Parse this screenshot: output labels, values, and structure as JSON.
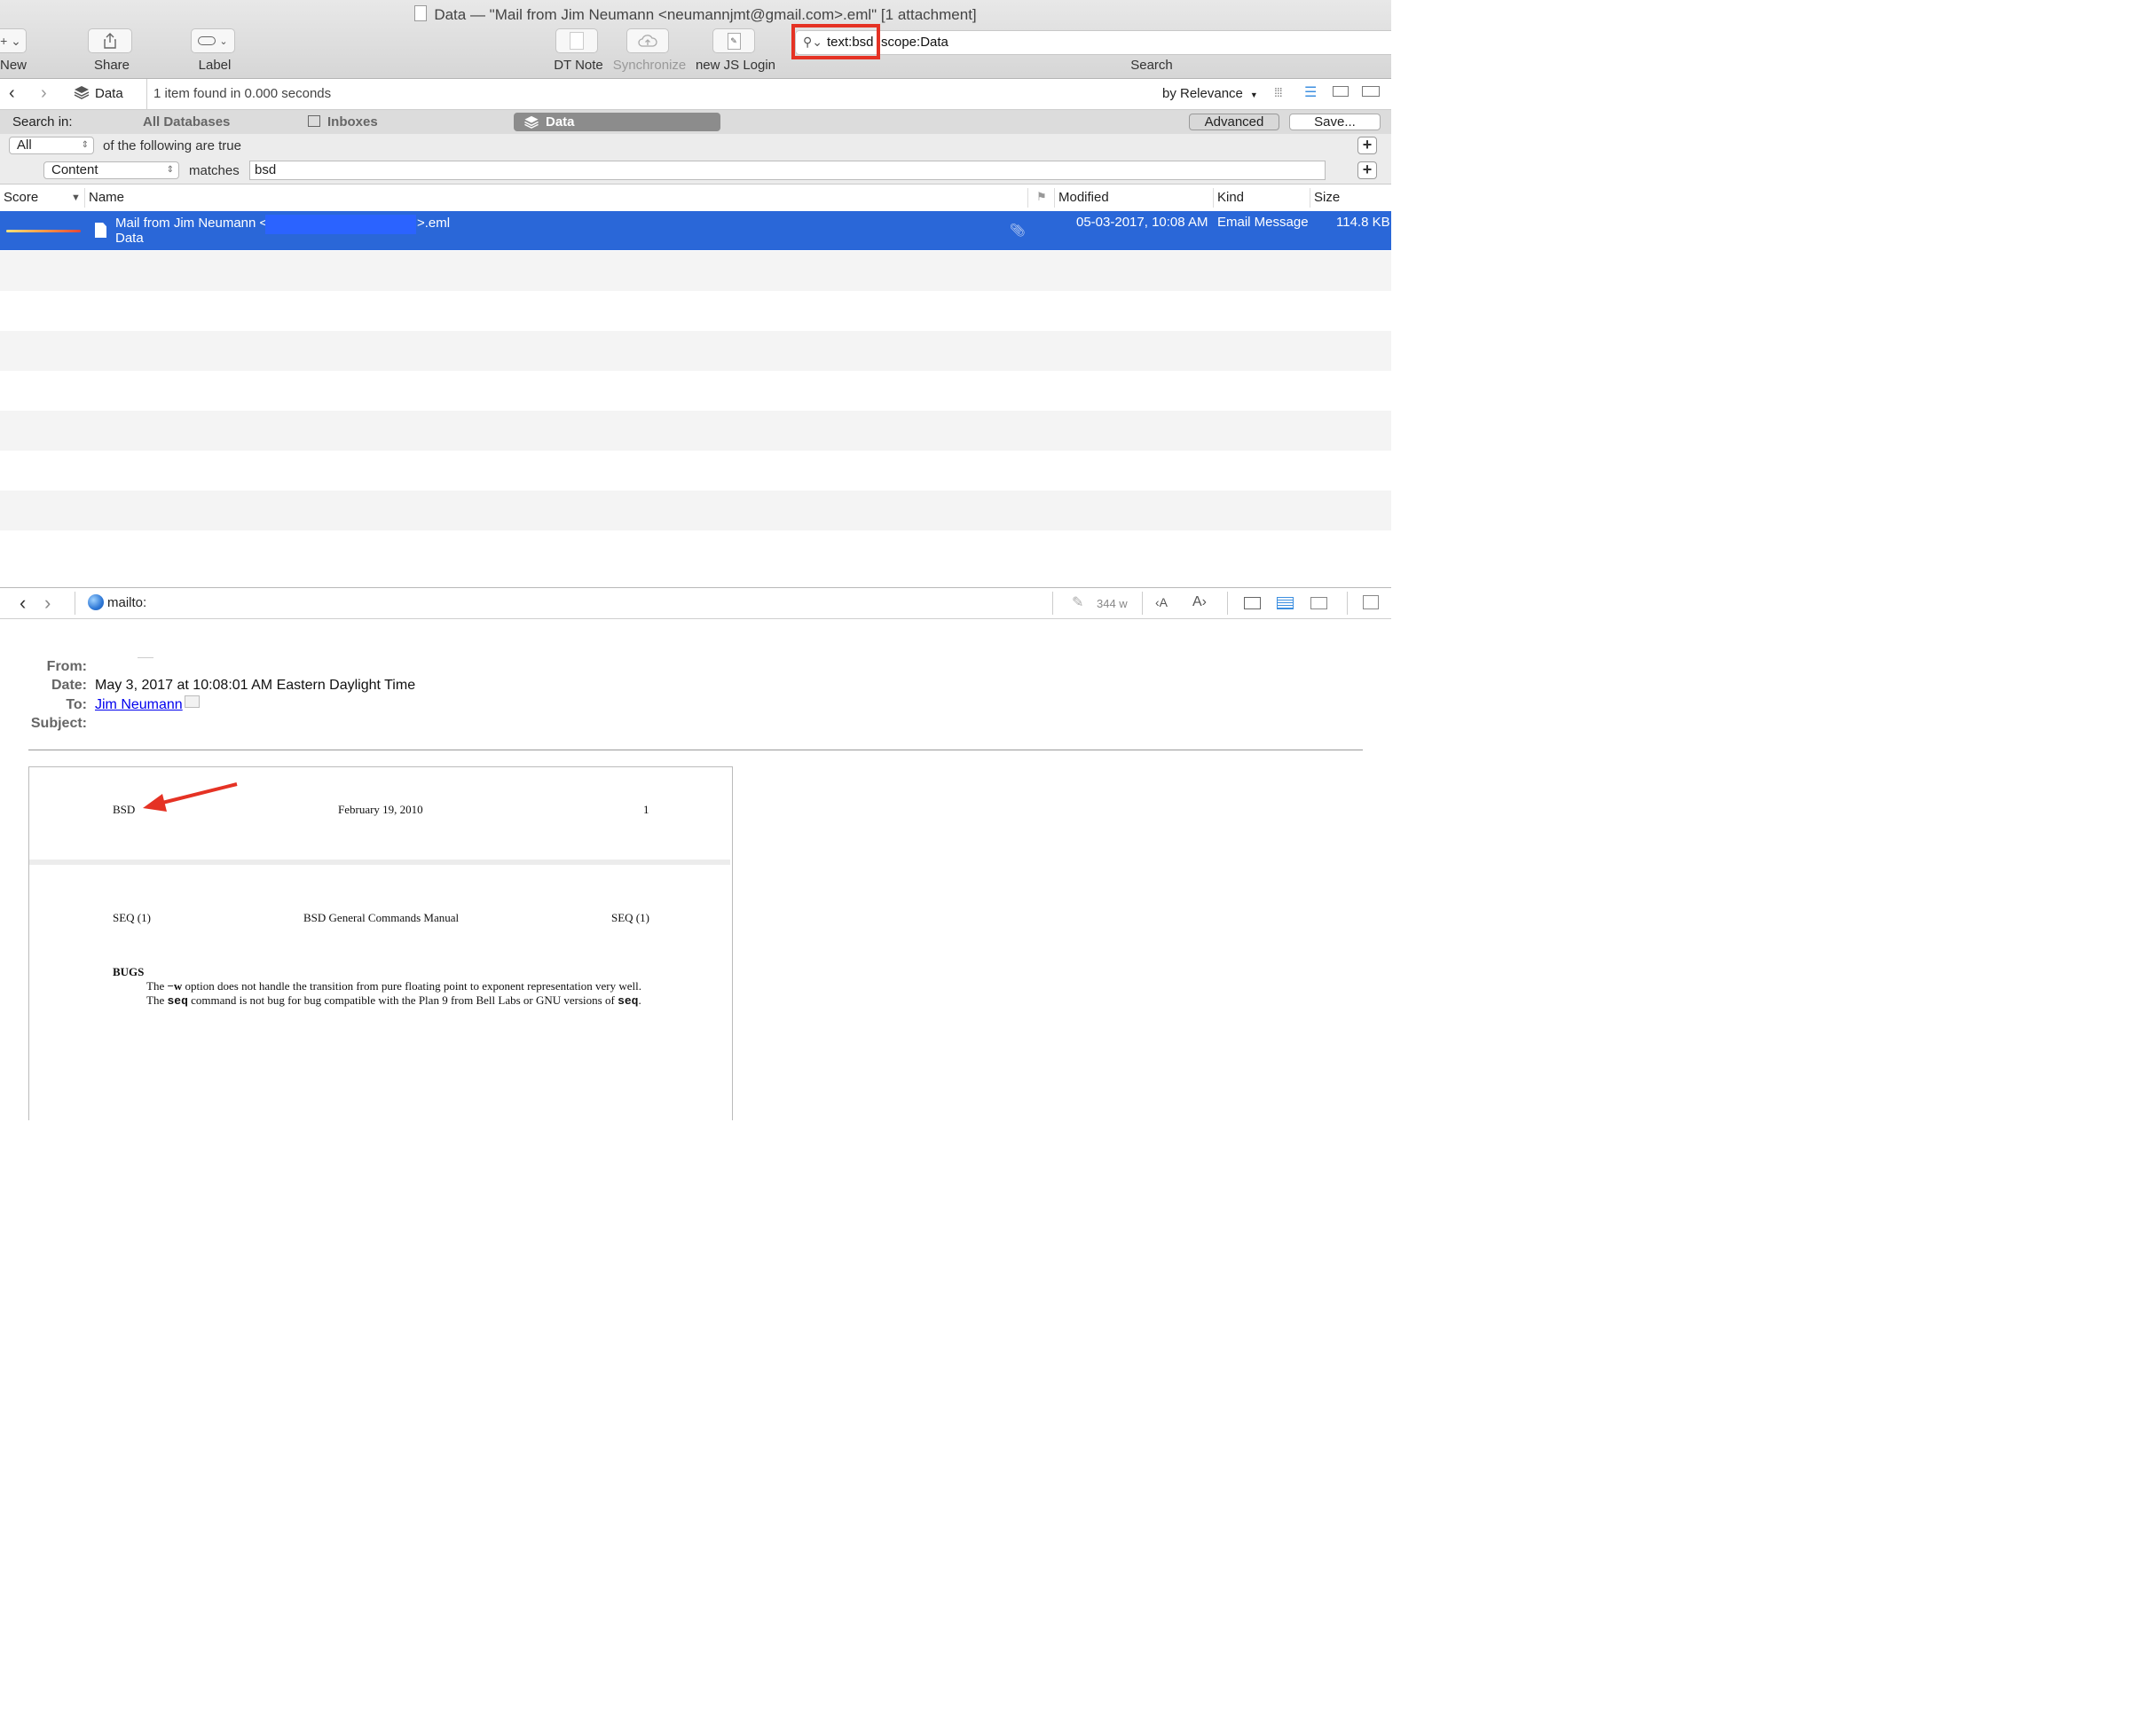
{
  "window": {
    "title": "Data — \"Mail from Jim Neumann <neumannjmt@gmail.com>.eml\" [1 attachment]"
  },
  "toolbar": {
    "new_label": "New",
    "share_label": "Share",
    "label_label": "Label",
    "dt_note_label": "DT Note",
    "synchronize_label": "Synchronize",
    "new_js_login_label": "new JS Login",
    "search_label": "Search",
    "search_query_highlighted": "text:bsd",
    "search_query_rest": "scope:Data"
  },
  "pathbar": {
    "database": "Data",
    "status": "1 item found in 0.000 seconds",
    "sort": "by Relevance"
  },
  "scope": {
    "label": "Search in:",
    "all_databases": "All Databases",
    "inboxes": "Inboxes",
    "data": "Data",
    "advanced_label": "Advanced",
    "save_label": "Save..."
  },
  "criteria": {
    "match_mode": "All",
    "match_text": "of the following are true",
    "field": "Content",
    "operator": "matches",
    "value": "bsd"
  },
  "table": {
    "columns": {
      "score": "Score",
      "name": "Name",
      "modified": "Modified",
      "kind": "Kind",
      "size": "Size"
    },
    "rows": [
      {
        "name_prefix": "Mail from Jim Neumann <",
        "name_suffix": ">.eml",
        "location": "Data",
        "modified": "05-03-2017, 10:08 AM",
        "kind": "Email Message",
        "size": "114.8 KB"
      }
    ]
  },
  "detail_toolbar": {
    "url": "mailto:",
    "word_count": "344 w"
  },
  "email": {
    "from_label": "From:",
    "date_label": "Date:",
    "date_value": "May 3, 2017 at 10:08:01 AM Eastern Daylight Time",
    "to_label": "To:",
    "to_value": "Jim Neumann",
    "subject_label": "Subject:"
  },
  "document": {
    "footer_left": "BSD",
    "footer_center": "February 19, 2010",
    "footer_right": "1",
    "header_left": "SEQ (1)",
    "header_center": "BSD General Commands Manual",
    "header_right": "SEQ (1)",
    "section_title": "BUGS",
    "line1_pre": "The ",
    "line1_bold": "−w",
    "line1_post": " option does not handle the transition from pure floating point to exponent representation very well.",
    "line2_pre": "The ",
    "line2_bold": "seq",
    "line2_mid": " command is not bug for bug compatible with the Plan 9 from Bell Labs or GNU versions of ",
    "line2_bold2": "seq",
    "line2_end": "."
  },
  "colors": {
    "selection": "#2a67d8",
    "highlight_box": "#e53224",
    "annotation_arrow": "#e53224"
  }
}
